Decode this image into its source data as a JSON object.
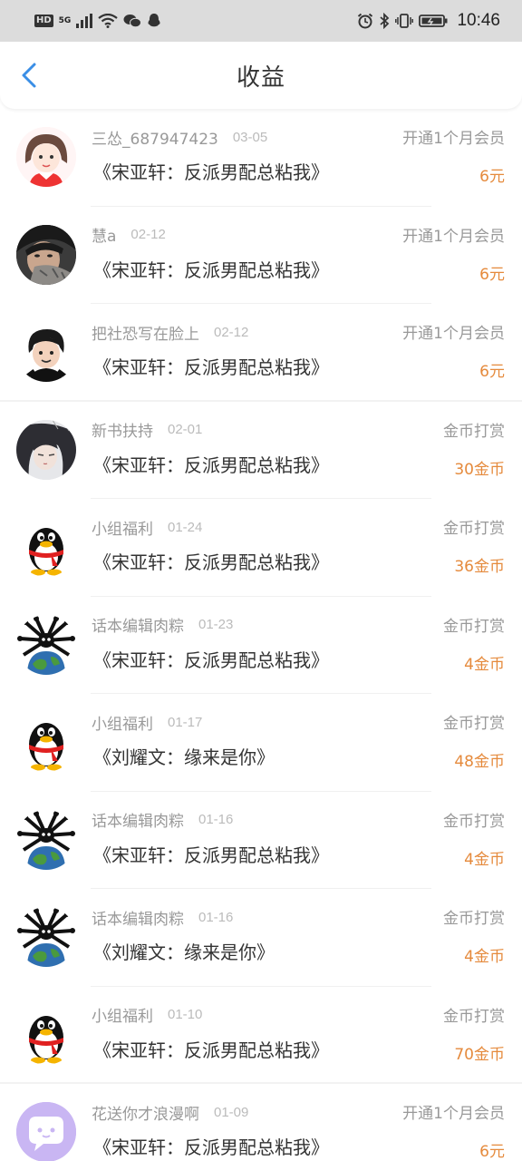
{
  "status_bar": {
    "hd": "HD",
    "network": "5G",
    "time": "10:46"
  },
  "header": {
    "title": "收益"
  },
  "items": [
    {
      "name": "三怂_687947423",
      "date": "03-05",
      "type": "开通1个月会员",
      "book": "《宋亚轩：反派男配总粘我》",
      "amount": "6元",
      "avatar": "girl-avatar"
    },
    {
      "name": "慧a",
      "date": "02-12",
      "type": "开通1个月会员",
      "book": "《宋亚轩：反派男配总粘我》",
      "amount": "6元",
      "avatar": "photo-avatar"
    },
    {
      "name": "把社恐写在脸上",
      "date": "02-12",
      "type": "开通1个月会员",
      "book": "《宋亚轩：反派男配总粘我》",
      "amount": "6元",
      "avatar": "cartoon-boy-avatar"
    },
    {
      "name": "新书扶持",
      "date": "02-01",
      "type": "金币打赏",
      "book": "《宋亚轩：反派男配总粘我》",
      "amount": "30金币",
      "avatar": "anime-avatar"
    },
    {
      "name": "小组福利",
      "date": "01-24",
      "type": "金币打赏",
      "book": "《宋亚轩：反派男配总粘我》",
      "amount": "36金币",
      "avatar": "penguin-avatar"
    },
    {
      "name": "话本编辑肉粽",
      "date": "01-23",
      "type": "金币打赏",
      "book": "《宋亚轩：反派男配总粘我》",
      "amount": "4金币",
      "avatar": "spider-globe-avatar"
    },
    {
      "name": "小组福利",
      "date": "01-17",
      "type": "金币打赏",
      "book": "《刘耀文：缘来是你》",
      "amount": "48金币",
      "avatar": "penguin-avatar"
    },
    {
      "name": "话本编辑肉粽",
      "date": "01-16",
      "type": "金币打赏",
      "book": "《宋亚轩：反派男配总粘我》",
      "amount": "4金币",
      "avatar": "spider-globe-avatar"
    },
    {
      "name": "话本编辑肉粽",
      "date": "01-16",
      "type": "金币打赏",
      "book": "《刘耀文：缘来是你》",
      "amount": "4金币",
      "avatar": "spider-globe-avatar"
    },
    {
      "name": "小组福利",
      "date": "01-10",
      "type": "金币打赏",
      "book": "《宋亚轩：反派男配总粘我》",
      "amount": "70金币",
      "avatar": "penguin-avatar"
    },
    {
      "name": "花送你才浪漫啊",
      "date": "01-09",
      "type": "开通1个月会员",
      "book": "《宋亚轩：反派男配总粘我》",
      "amount": "6元",
      "avatar": "chat-bubble-avatar"
    }
  ],
  "colors": {
    "amount": "#e58a3c",
    "back_arrow": "#3a8ee6",
    "status_bar_bg": "#dcdcdc"
  }
}
